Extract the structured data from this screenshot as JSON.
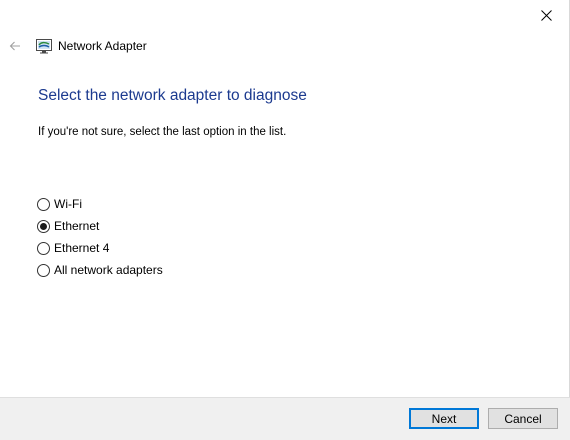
{
  "window": {
    "title": "Network Adapter",
    "close_icon": "close-icon",
    "back_icon": "arrow-left-icon",
    "app_icon": "network-adapter-icon"
  },
  "main": {
    "heading": "Select the network adapter to diagnose",
    "instruction": "If you're not sure, select the last option in the list.",
    "options": [
      {
        "label": "Wi-Fi",
        "selected": false
      },
      {
        "label": "Ethernet",
        "selected": true
      },
      {
        "label": "Ethernet 4",
        "selected": false
      },
      {
        "label": "All network adapters",
        "selected": false
      }
    ]
  },
  "footer": {
    "next_label": "Next",
    "cancel_label": "Cancel"
  },
  "colors": {
    "heading": "#1c3a8f",
    "footer_bg": "#f0f0f0",
    "default_button_border": "#0078d7"
  }
}
